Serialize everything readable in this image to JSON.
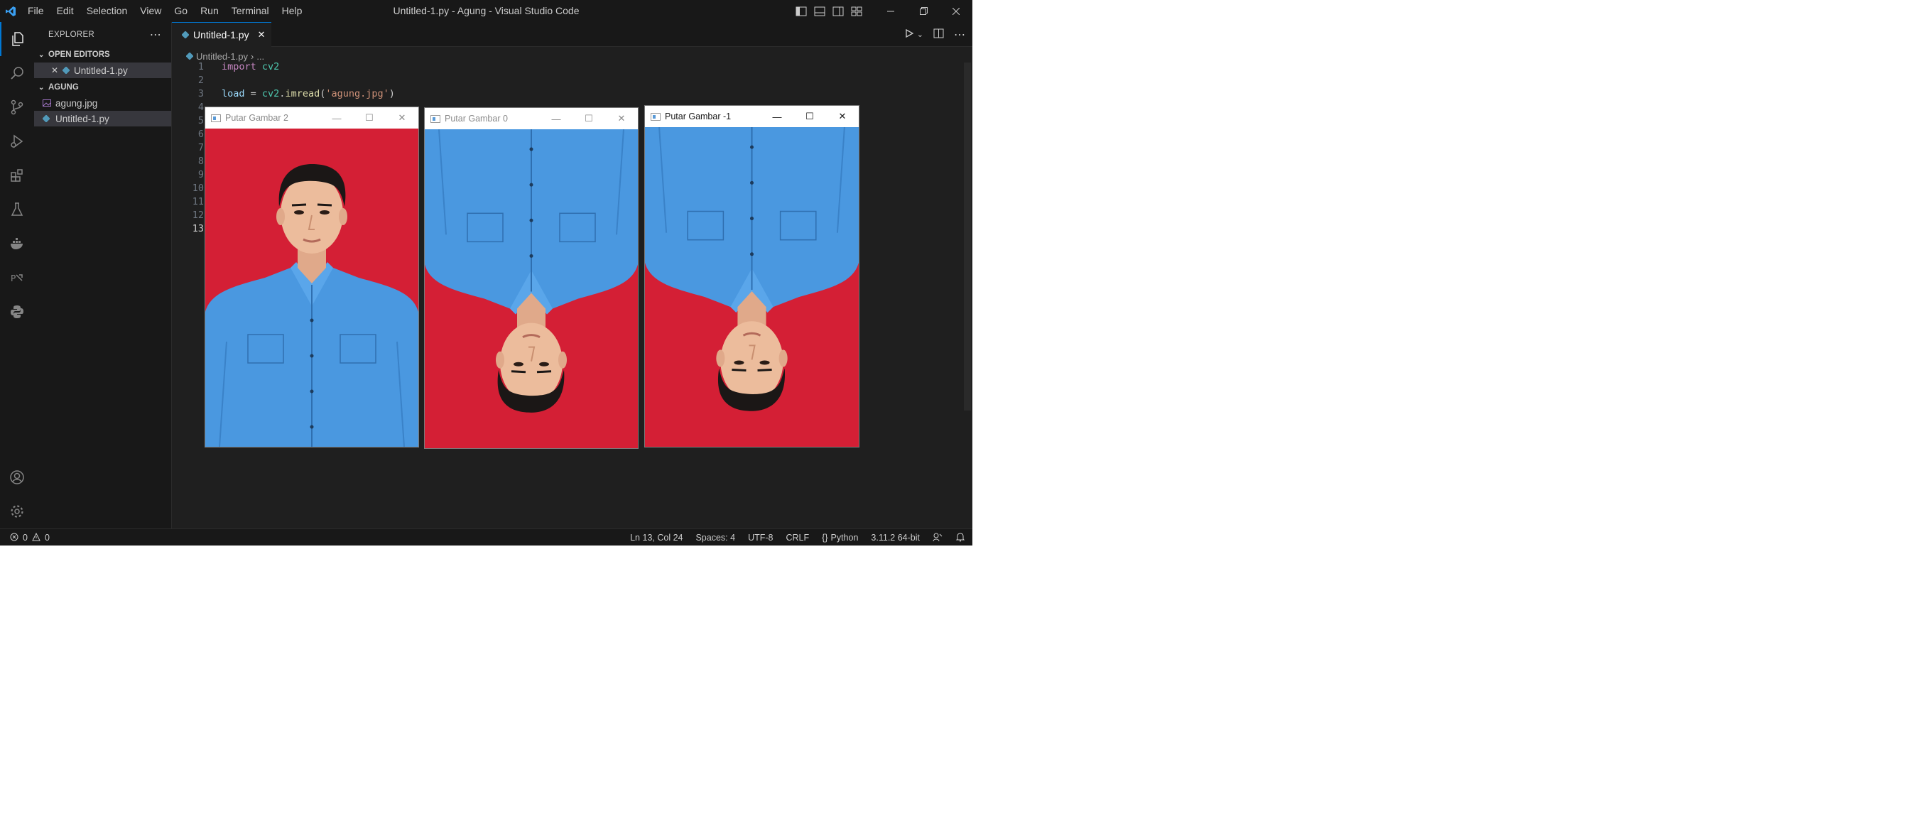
{
  "titlebar": {
    "menu": [
      "File",
      "Edit",
      "Selection",
      "View",
      "Go",
      "Run",
      "Terminal",
      "Help"
    ],
    "window_title": "Untitled-1.py - Agung - Visual Studio Code"
  },
  "sidebar": {
    "header": "EXPLORER",
    "open_editors_label": "OPEN EDITORS",
    "open_editors": [
      {
        "name": "Untitled-1.py"
      }
    ],
    "folder_label": "AGUNG",
    "files": [
      {
        "name": "agung.jpg",
        "icon": "image-file-icon"
      },
      {
        "name": "Untitled-1.py",
        "icon": "python-file-icon"
      }
    ]
  },
  "editor": {
    "tab_label": "Untitled-1.py",
    "breadcrumb_file": "Untitled-1.py",
    "breadcrumb_more": "...",
    "line_numbers": [
      "1",
      "2",
      "3",
      "4",
      "5",
      "6",
      "7",
      "8",
      "9",
      "10",
      "11",
      "12",
      "13"
    ],
    "active_line": "13",
    "code": {
      "line1_kw": "import",
      "line1_mod": "cv2",
      "line3_var": "load",
      "line3_eq": " = ",
      "line3_mod": "cv2",
      "line3_dot": ".",
      "line3_fn": "imread",
      "line3_open": "(",
      "line3_str": "'agung.jpg'",
      "line3_close": ")"
    }
  },
  "windows": [
    {
      "title": "Putar Gambar 2",
      "state": "inactive",
      "rotation": 0
    },
    {
      "title": "Putar Gambar 0",
      "state": "inactive",
      "rotation": 180
    },
    {
      "title": "Putar Gambar -1",
      "state": "active",
      "rotation": 180
    }
  ],
  "window_buttons": {
    "minimize": "—",
    "maximize": "☐",
    "close": "✕"
  },
  "statusbar": {
    "errors": "0",
    "warnings": "0",
    "position": "Ln 13, Col 24",
    "spaces": "Spaces: 4",
    "encoding": "UTF-8",
    "eol": "CRLF",
    "language": "Python",
    "interpreter": "3.11.2 64-bit"
  },
  "colors": {
    "accent": "#0078d4",
    "backdrop_red": "#d41f35",
    "shirt_blue": "#4a98e0"
  }
}
